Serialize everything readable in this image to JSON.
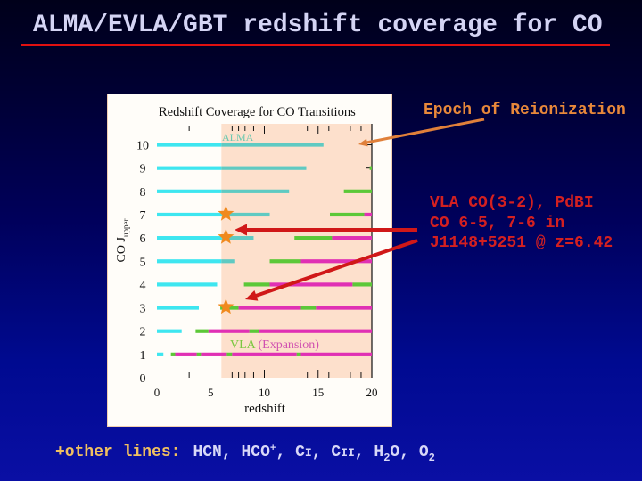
{
  "slide": {
    "title": "ALMA/EVLA/GBT redshift coverage for CO",
    "colors": {
      "title": "#d4d4f4",
      "underline": "#e01010",
      "reionization_annotation": "#e8883a",
      "detection_annotation": "#d42020",
      "footer_prefix": "#f0c060",
      "footer_text": "#d8d8f8"
    }
  },
  "annotations": {
    "reionization": "Epoch of Reionization",
    "detection_lines": [
      "VLA CO(3-2), PdBI",
      "CO 6-5, 7-6 in",
      "J1148+5251 @ z=6.42"
    ]
  },
  "footer": {
    "prefix": "+other lines:",
    "separator": ",",
    "hcn": "HCN",
    "hco_base": "HCO",
    "hco_sup": "+",
    "ci_base": "C",
    "ci_sc": "I",
    "cii_base": "C",
    "cii_sc": "II",
    "h2o_h": "H",
    "h2o_sub": "2",
    "h2o_o": "O",
    "o2_base": "O",
    "o2_sub": "2"
  },
  "chart_data": {
    "type": "bar",
    "subtype": "horizontal-range",
    "title": "Redshift Coverage for CO Transitions",
    "xlabel": "redshift",
    "ylabel": "CO J",
    "ylabel_subscript": "upper",
    "xlim": [
      0,
      20
    ],
    "ylim": [
      0,
      10.9
    ],
    "grid": false,
    "x_ticks": [
      0,
      5,
      10,
      15,
      20
    ],
    "x_tick_labels": [
      "0",
      "5",
      "10",
      "15",
      "20"
    ],
    "x_minor_ticks": [
      3,
      7,
      7.6,
      8.2,
      9,
      10,
      14,
      15,
      16,
      18,
      19,
      20
    ],
    "x_major_ticks": [
      10,
      15,
      20
    ],
    "y_ticks": [
      0,
      1,
      2,
      3,
      4,
      5,
      6,
      7,
      8,
      9,
      10
    ],
    "y_tick_labels": [
      "0",
      "1",
      "2",
      "3",
      "4",
      "5",
      "6",
      "7",
      "8",
      "9",
      "10"
    ],
    "shaded_region": {
      "z_from": 6,
      "z_to": 20,
      "color": "#fde0cc",
      "meaning": "Epoch of Reionization"
    },
    "legend_labels": [
      {
        "text": "ALMA",
        "color": "#6cc8b0",
        "position": "top-left-of-shade"
      },
      {
        "parts": [
          {
            "text": "VLA",
            "color": "#7ac840"
          },
          {
            "text": " (Expansion)",
            "color": "#d050b0"
          }
        ],
        "position": "bottom-left-of-shade"
      }
    ],
    "series": [
      {
        "name": "ALMA",
        "color": "#3ee6f0",
        "color_in_shade": "#5fcac2",
        "segments": [
          {
            "J": 10,
            "z": [
              0,
              15.5
            ]
          },
          {
            "J": 9,
            "z": [
              0,
              13.9
            ]
          },
          {
            "J": 8,
            "z": [
              0,
              12.3
            ]
          },
          {
            "J": 7,
            "z": [
              0,
              10.5
            ]
          },
          {
            "J": 6,
            "z": [
              0,
              9.0
            ]
          },
          {
            "J": 5,
            "z": [
              0,
              7.2
            ]
          },
          {
            "J": 4,
            "z": [
              0,
              5.6
            ]
          },
          {
            "J": 3,
            "z": [
              0,
              3.9
            ]
          },
          {
            "J": 2,
            "z": [
              0,
              2.3
            ]
          },
          {
            "J": 1,
            "z": [
              0,
              0.6
            ]
          }
        ]
      },
      {
        "name": "VLA",
        "color": "#5cc838",
        "segments": [
          {
            "J": 9,
            "z": [
              19.8,
              20
            ]
          },
          {
            "J": 8,
            "z": [
              17.4,
              20
            ]
          },
          {
            "J": 7,
            "z": [
              16.1,
              19.3
            ]
          },
          {
            "J": 6,
            "z": [
              12.8,
              16.3
            ]
          },
          {
            "J": 5,
            "z": [
              10.5,
              13.4
            ]
          },
          {
            "J": 4,
            "z": [
              8.1,
              10.5
            ]
          },
          {
            "J": 4,
            "z": [
              18.2,
              20
            ]
          },
          {
            "J": 3,
            "z": [
              5.9,
              7.6
            ]
          },
          {
            "J": 3,
            "z": [
              13.4,
              14.8
            ]
          },
          {
            "J": 2,
            "z": [
              3.6,
              4.8
            ]
          },
          {
            "J": 2,
            "z": [
              8.6,
              9.5
            ]
          },
          {
            "J": 1,
            "z": [
              1.3,
              1.7
            ]
          },
          {
            "J": 1,
            "z": [
              3.7,
              4.1
            ]
          },
          {
            "J": 1,
            "z": [
              6.5,
              7.0
            ]
          },
          {
            "J": 1,
            "z": [
              13.0,
              13.4
            ]
          }
        ]
      },
      {
        "name": "VLA Expansion",
        "color": "#e030b4",
        "segments": [
          {
            "J": 7,
            "z": [
              19.3,
              20
            ]
          },
          {
            "J": 6,
            "z": [
              16.3,
              20
            ]
          },
          {
            "J": 5,
            "z": [
              13.4,
              20
            ]
          },
          {
            "J": 4,
            "z": [
              10.5,
              18.2
            ]
          },
          {
            "J": 3,
            "z": [
              7.6,
              13.4
            ]
          },
          {
            "J": 3,
            "z": [
              14.8,
              20
            ]
          },
          {
            "J": 2,
            "z": [
              4.8,
              8.6
            ]
          },
          {
            "J": 2,
            "z": [
              9.5,
              20
            ]
          },
          {
            "J": 1,
            "z": [
              1.7,
              3.7
            ]
          },
          {
            "J": 1,
            "z": [
              4.1,
              6.5
            ]
          },
          {
            "J": 1,
            "z": [
              7.0,
              13.0
            ]
          },
          {
            "J": 1,
            "z": [
              13.4,
              20
            ]
          }
        ]
      }
    ],
    "markers": {
      "name": "J1148+5251 detections",
      "shape": "star",
      "color": "#f08a1e",
      "z": 6.42,
      "J": [
        7,
        6,
        3
      ]
    }
  }
}
